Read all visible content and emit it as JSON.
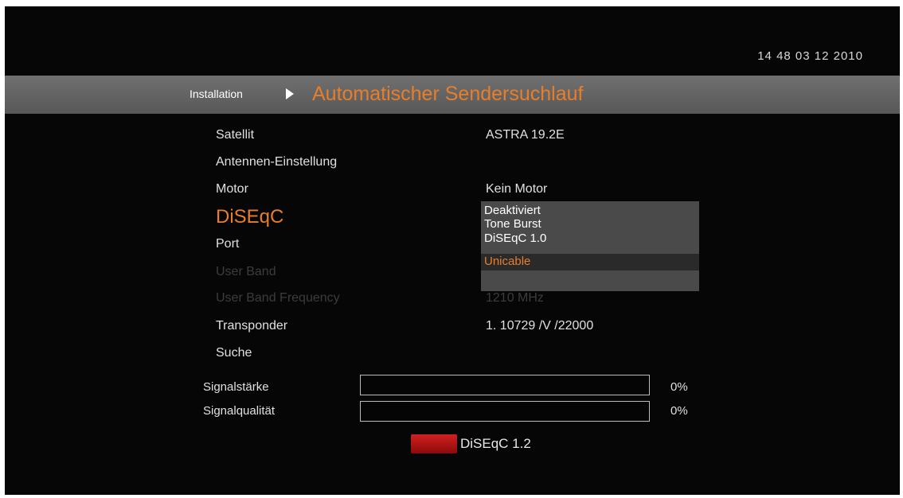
{
  "clock": "14 48   03 12 2010",
  "header": {
    "breadcrumb": "Installation",
    "title": "Automatischer Sendersuchlauf"
  },
  "rows": [
    {
      "label": "Satellit",
      "value": "ASTRA 19.2E"
    },
    {
      "label": "Antennen-Einstellung",
      "value": ""
    },
    {
      "label": "Motor",
      "value": "Kein Motor"
    },
    {
      "label": "DiSEqC",
      "value": ""
    },
    {
      "label": "Port",
      "value": ""
    },
    {
      "label": "User Band",
      "value": ""
    },
    {
      "label": "User Band Frequency",
      "value": "1210 MHz"
    },
    {
      "label": "Transponder",
      "value": "1. 10729 /V /22000"
    },
    {
      "label": "Suche",
      "value": ""
    }
  ],
  "dropdown": {
    "options": [
      "Deaktiviert",
      "Tone Burst",
      "DiSEqC 1.0",
      "Unicable"
    ],
    "selected": "Unicable"
  },
  "signal": {
    "strength_label": "Signalstärke",
    "strength_value": "0%",
    "strength_fraction": 0,
    "quality_label": "Signalqualität",
    "quality_value": "0%",
    "quality_fraction": 0
  },
  "footer": {
    "red_button_label": "DiSEqC 1.2"
  },
  "colors": {
    "accent": "#e87e2a",
    "red_key": "#c41818"
  },
  "icons": {
    "breadcrumb_separator": "play-arrow-icon"
  }
}
